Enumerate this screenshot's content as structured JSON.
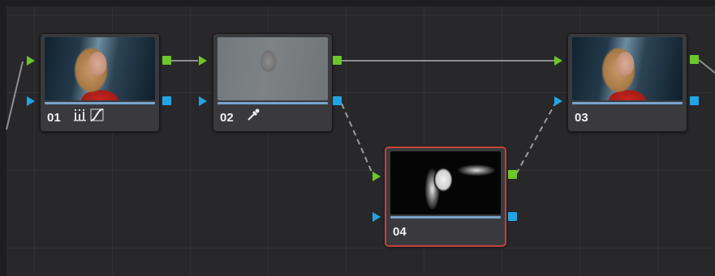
{
  "colors": {
    "background": "#28282b",
    "link": "#9a9a9a",
    "rgb_port": "#6dc62a",
    "key_port": "#22a4e2",
    "selected_border": "#c5403a"
  },
  "nodes": [
    {
      "id": "01",
      "label": "01",
      "tools": [
        "color-wheels-icon",
        "curves-icon"
      ],
      "thumbnail": "portrait-color",
      "selected": false
    },
    {
      "id": "02",
      "label": "02",
      "tools": [
        "eyedropper-icon"
      ],
      "thumbnail": "portrait-faded",
      "selected": false
    },
    {
      "id": "03",
      "label": "03",
      "tools": [],
      "thumbnail": "portrait-color",
      "selected": false
    },
    {
      "id": "04",
      "label": "04",
      "tools": [],
      "thumbnail": "portrait-mask",
      "selected": true
    }
  ],
  "connections": [
    {
      "from": "input",
      "to": "01",
      "type": "rgb"
    },
    {
      "from": "01",
      "to": "02",
      "type": "rgb"
    },
    {
      "from": "02",
      "to": "03",
      "type": "rgb"
    },
    {
      "from": "02",
      "to": "04",
      "type": "key"
    },
    {
      "from": "04",
      "to": "03",
      "type": "key"
    },
    {
      "from": "03",
      "to": "output",
      "type": "rgb"
    }
  ]
}
